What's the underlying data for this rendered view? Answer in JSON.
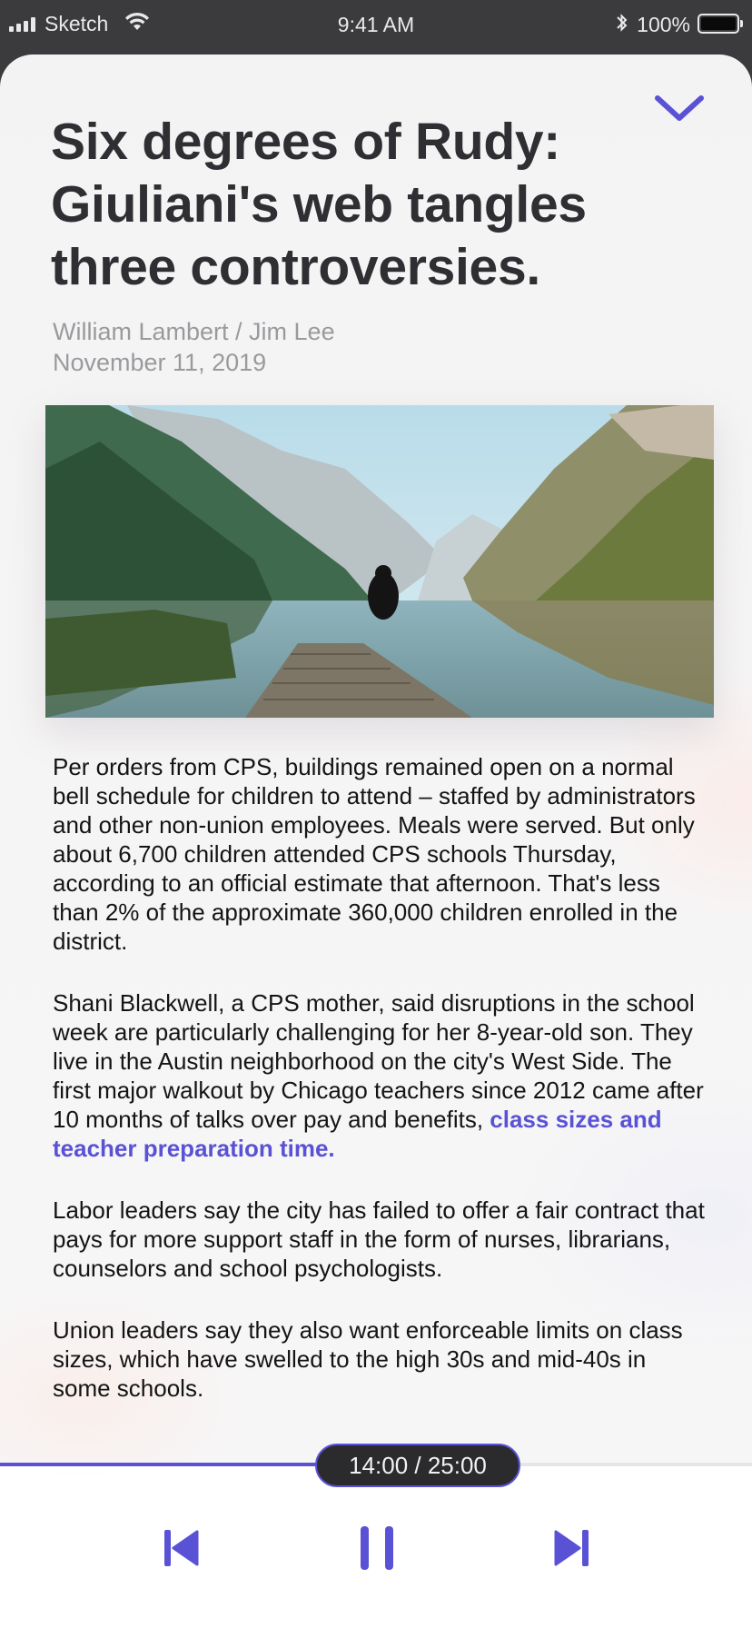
{
  "status_bar": {
    "carrier": "Sketch",
    "time": "9:41 AM",
    "battery": "100%"
  },
  "article": {
    "title": "Six degrees of Rudy: Giuliani's web tangles three controversies.",
    "authors": "William Lambert / Jim Lee",
    "date": "November 11, 2019",
    "paragraphs": [
      "Per orders from CPS, buildings remained open on a normal bell schedule for children to attend – staffed by administrators and other non-union employees. Meals were served. But only about 6,700 children attended CPS schools Thursday, according to an official estimate that afternoon. That's less than 2% of the approximate 360,000 children enrolled in the district.",
      "Shani Blackwell, a CPS mother, said disruptions in the school week are particularly challenging for her 8-year-old son. They live in the Austin neighborhood on the city's West Side. The first major walkout by Chicago teachers since 2012 came after 10 months of talks over pay and benefits, ",
      "Labor leaders say the city has failed to offer a fair contract that pays for more support staff in the form of nurses, librarians, counselors and school psychologists.",
      "Union leaders say they also want enforceable limits on class sizes, which have swelled to the high 30s and mid-40s in some schools."
    ],
    "link_text": "class sizes and teacher preparation time."
  },
  "player": {
    "elapsed": "14:00",
    "total": "25:00",
    "time_label": "14:00 / 25:00",
    "progress": 0.56
  },
  "icons": {
    "collapse": "chevron-down-icon",
    "previous": "skip-previous-icon",
    "pause": "pause-icon",
    "next": "skip-next-icon"
  },
  "colors": {
    "accent": "#5a52d5",
    "status_bar": "#3b3b3d",
    "title": "#2f2f33",
    "meta": "#9a9a9e",
    "pill": "#2b2b2e"
  }
}
